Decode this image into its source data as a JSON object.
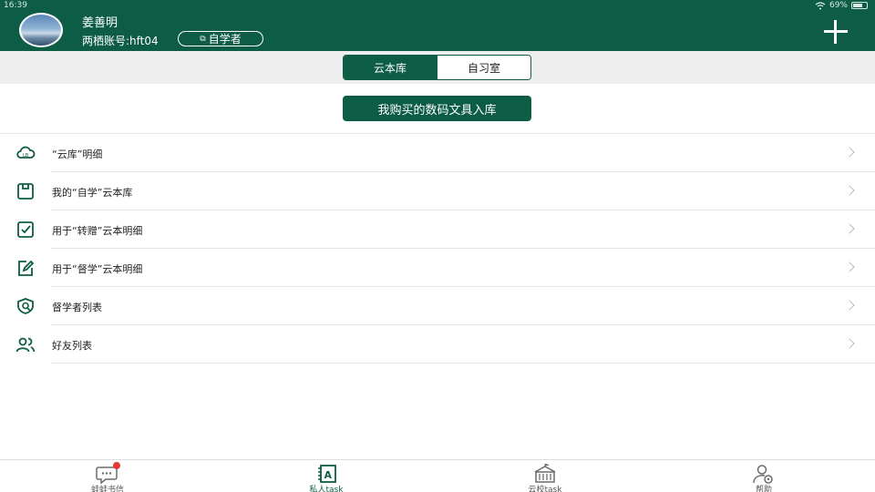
{
  "status_bar": {
    "time": "16:39",
    "battery": "69%"
  },
  "header": {
    "user_name": "姜善明",
    "account_label": "两栖账号:",
    "account_id": "hft04",
    "role_badge": "自学者"
  },
  "tabs": [
    {
      "label": "云本库",
      "active": true
    },
    {
      "label": "自习室",
      "active": false
    }
  ],
  "primary_action": {
    "label": "我购买的数码文具入库"
  },
  "menu": [
    {
      "label": "“云库”明细",
      "icon": "cloud-icon"
    },
    {
      "label": "我的“自学”云本库",
      "icon": "notebook-icon"
    },
    {
      "label": "用于“转赠”云本明细",
      "icon": "notebook-check-icon"
    },
    {
      "label": "用于“督学”云本明细",
      "icon": "edit-icon"
    },
    {
      "label": "督学者列表",
      "icon": "shield-icon"
    },
    {
      "label": "好友列表",
      "icon": "friends-icon"
    }
  ],
  "bottom_nav": [
    {
      "label": "蛙蛙书信",
      "icon": "chat-icon",
      "active": false,
      "badge": true
    },
    {
      "label": "私人task",
      "icon": "notebook-a-icon",
      "active": true
    },
    {
      "label": "云校task",
      "icon": "school-icon",
      "active": false
    },
    {
      "label": "帮助",
      "icon": "help-user-icon",
      "active": false
    }
  ],
  "colors": {
    "primary": "#0d5c45",
    "background": "#ffffff",
    "tab_bar": "#eeeeee",
    "badge": "#e53935"
  }
}
